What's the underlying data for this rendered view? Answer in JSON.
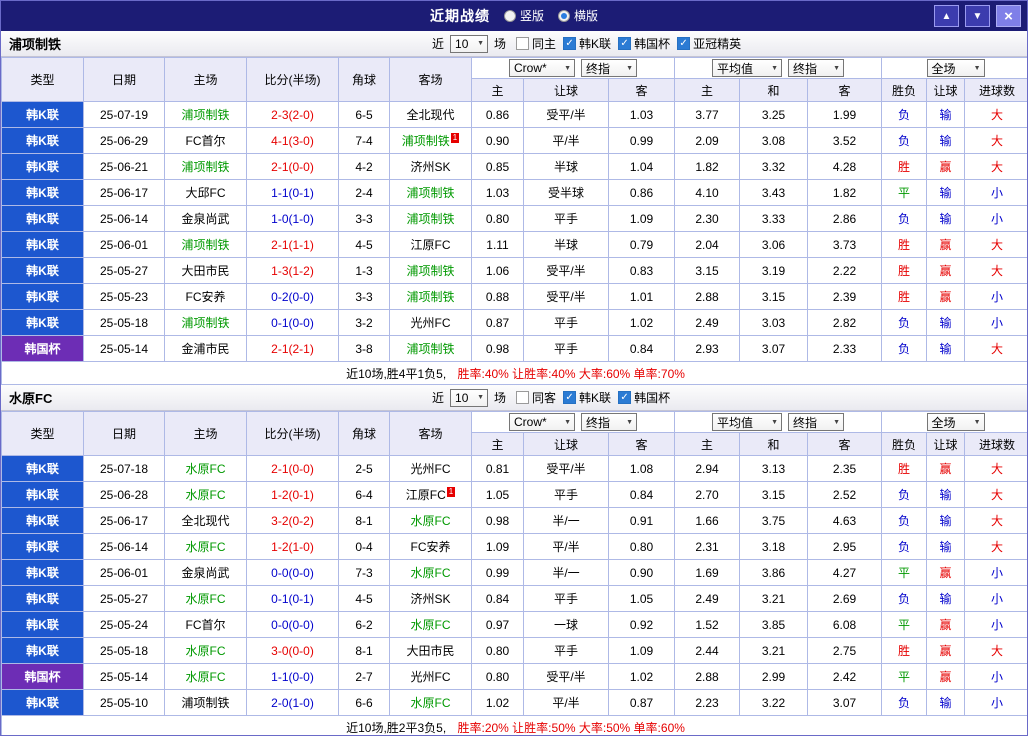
{
  "titlebar": {
    "title": "近期战绩",
    "radios": [
      {
        "label": "竖版",
        "selected": false
      },
      {
        "label": "横版",
        "selected": true
      }
    ],
    "buttons": {
      "up": "▲",
      "down": "▼",
      "close": "×"
    }
  },
  "controls": {
    "near_label": "近",
    "count_value": "10",
    "unit_label": "场",
    "dropdown_arrow": "▼",
    "check_icon": "✓",
    "bk_select": "Crow*",
    "final_select": "终指",
    "avg_select": "平均值",
    "scope_select": "全场"
  },
  "headers": [
    "类型",
    "日期",
    "主场",
    "比分(半场)",
    "角球",
    "客场",
    "主",
    "让球",
    "客",
    "主",
    "和",
    "客",
    "胜负",
    "让球",
    "进球数"
  ],
  "colors": {
    "titlebar_bg": "#1c1c75",
    "league_k_bg": "#1d57cf",
    "league_cup_bg": "#6d2db5",
    "focus_team": "#009900",
    "win_red": "#e60000",
    "draw_green": "#009900",
    "lose_blue": "#0000cc"
  },
  "sections": [
    {
      "team": "浦项制铁",
      "filters": [
        {
          "label": "同主",
          "checked": false
        },
        {
          "label": "韩K联",
          "checked": true
        },
        {
          "label": "韩国杯",
          "checked": true
        },
        {
          "label": "亚冠精英",
          "checked": true
        }
      ],
      "rows": [
        {
          "lg": "韩K联",
          "cup": false,
          "date": "25-07-19",
          "home": "浦项制铁",
          "hf": true,
          "hrc": "",
          "score": "2-3(2-0)",
          "big": true,
          "corner": "6-5",
          "away": "全北现代",
          "af": false,
          "arc": "",
          "ah": [
            "0.86",
            "受平/半",
            "1.03"
          ],
          "eu": [
            "3.77",
            "3.25",
            "1.99"
          ],
          "res": [
            [
              "负",
              "l"
            ],
            [
              "输",
              "l"
            ],
            [
              "大",
              "w"
            ]
          ]
        },
        {
          "lg": "韩K联",
          "cup": false,
          "date": "25-06-29",
          "home": "FC首尔",
          "hf": false,
          "hrc": "",
          "score": "4-1(3-0)",
          "big": true,
          "corner": "7-4",
          "away": "浦项制铁",
          "af": true,
          "arc": "1",
          "ah": [
            "0.90",
            "平/半",
            "0.99"
          ],
          "eu": [
            "2.09",
            "3.08",
            "3.52"
          ],
          "res": [
            [
              "负",
              "l"
            ],
            [
              "输",
              "l"
            ],
            [
              "大",
              "w"
            ]
          ]
        },
        {
          "lg": "韩K联",
          "cup": false,
          "date": "25-06-21",
          "home": "浦项制铁",
          "hf": true,
          "hrc": "",
          "score": "2-1(0-0)",
          "big": true,
          "corner": "4-2",
          "away": "济州SK",
          "af": false,
          "arc": "",
          "ah": [
            "0.85",
            "半球",
            "1.04"
          ],
          "eu": [
            "1.82",
            "3.32",
            "4.28"
          ],
          "res": [
            [
              "胜",
              "w"
            ],
            [
              "赢",
              "w"
            ],
            [
              "大",
              "w"
            ]
          ]
        },
        {
          "lg": "韩K联",
          "cup": false,
          "date": "25-06-17",
          "home": "大邱FC",
          "hf": false,
          "hrc": "",
          "score": "1-1(0-1)",
          "big": false,
          "corner": "2-4",
          "away": "浦项制铁",
          "af": true,
          "arc": "",
          "ah": [
            "1.03",
            "受半球",
            "0.86"
          ],
          "eu": [
            "4.10",
            "3.43",
            "1.82"
          ],
          "res": [
            [
              "平",
              "d"
            ],
            [
              "输",
              "l"
            ],
            [
              "小",
              "l"
            ]
          ]
        },
        {
          "lg": "韩K联",
          "cup": false,
          "date": "25-06-14",
          "home": "金泉尚武",
          "hf": false,
          "hrc": "",
          "score": "1-0(1-0)",
          "big": false,
          "corner": "3-3",
          "away": "浦项制铁",
          "af": true,
          "arc": "",
          "ah": [
            "0.80",
            "平手",
            "1.09"
          ],
          "eu": [
            "2.30",
            "3.33",
            "2.86"
          ],
          "res": [
            [
              "负",
              "l"
            ],
            [
              "输",
              "l"
            ],
            [
              "小",
              "l"
            ]
          ]
        },
        {
          "lg": "韩K联",
          "cup": false,
          "date": "25-06-01",
          "home": "浦项制铁",
          "hf": true,
          "hrc": "",
          "score": "2-1(1-1)",
          "big": true,
          "corner": "4-5",
          "away": "江原FC",
          "af": false,
          "arc": "",
          "ah": [
            "1.11",
            "半球",
            "0.79"
          ],
          "eu": [
            "2.04",
            "3.06",
            "3.73"
          ],
          "res": [
            [
              "胜",
              "w"
            ],
            [
              "赢",
              "w"
            ],
            [
              "大",
              "w"
            ]
          ]
        },
        {
          "lg": "韩K联",
          "cup": false,
          "date": "25-05-27",
          "home": "大田市民",
          "hf": false,
          "hrc": "",
          "score": "1-3(1-2)",
          "big": true,
          "corner": "1-3",
          "away": "浦项制铁",
          "af": true,
          "arc": "",
          "ah": [
            "1.06",
            "受平/半",
            "0.83"
          ],
          "eu": [
            "3.15",
            "3.19",
            "2.22"
          ],
          "res": [
            [
              "胜",
              "w"
            ],
            [
              "赢",
              "w"
            ],
            [
              "大",
              "w"
            ]
          ]
        },
        {
          "lg": "韩K联",
          "cup": false,
          "date": "25-05-23",
          "home": "FC安养",
          "hf": false,
          "hrc": "",
          "score": "0-2(0-0)",
          "big": false,
          "corner": "3-3",
          "away": "浦项制铁",
          "af": true,
          "arc": "",
          "ah": [
            "0.88",
            "受平/半",
            "1.01"
          ],
          "eu": [
            "2.88",
            "3.15",
            "2.39"
          ],
          "res": [
            [
              "胜",
              "w"
            ],
            [
              "赢",
              "w"
            ],
            [
              "小",
              "l"
            ]
          ]
        },
        {
          "lg": "韩K联",
          "cup": false,
          "date": "25-05-18",
          "home": "浦项制铁",
          "hf": true,
          "hrc": "",
          "score": "0-1(0-0)",
          "big": false,
          "corner": "3-2",
          "away": "光州FC",
          "af": false,
          "arc": "",
          "ah": [
            "0.87",
            "平手",
            "1.02"
          ],
          "eu": [
            "2.49",
            "3.03",
            "2.82"
          ],
          "res": [
            [
              "负",
              "l"
            ],
            [
              "输",
              "l"
            ],
            [
              "小",
              "l"
            ]
          ]
        },
        {
          "lg": "韩国杯",
          "cup": true,
          "date": "25-05-14",
          "home": "金浦市民",
          "hf": false,
          "hrc": "",
          "score": "2-1(2-1)",
          "big": true,
          "corner": "3-8",
          "away": "浦项制铁",
          "af": true,
          "arc": "",
          "ah": [
            "0.98",
            "平手",
            "0.84"
          ],
          "eu": [
            "2.93",
            "3.07",
            "2.33"
          ],
          "res": [
            [
              "负",
              "l"
            ],
            [
              "输",
              "l"
            ],
            [
              "大",
              "w"
            ]
          ]
        }
      ],
      "summary_plain": "近10场,胜4平1负5,",
      "summary_rates": "胜率:40% 让胜率:40% 大率:60% 单率:70%"
    },
    {
      "team": "水原FC",
      "filters": [
        {
          "label": "同客",
          "checked": false
        },
        {
          "label": "韩K联",
          "checked": true
        },
        {
          "label": "韩国杯",
          "checked": true
        }
      ],
      "rows": [
        {
          "lg": "韩K联",
          "cup": false,
          "date": "25-07-18",
          "home": "水原FC",
          "hf": true,
          "hrc": "",
          "score": "2-1(0-0)",
          "big": true,
          "corner": "2-5",
          "away": "光州FC",
          "af": false,
          "arc": "",
          "ah": [
            "0.81",
            "受平/半",
            "1.08"
          ],
          "eu": [
            "2.94",
            "3.13",
            "2.35"
          ],
          "res": [
            [
              "胜",
              "w"
            ],
            [
              "赢",
              "w"
            ],
            [
              "大",
              "w"
            ]
          ]
        },
        {
          "lg": "韩K联",
          "cup": false,
          "date": "25-06-28",
          "home": "水原FC",
          "hf": true,
          "hrc": "",
          "score": "1-2(0-1)",
          "big": true,
          "corner": "6-4",
          "away": "江原FC",
          "af": false,
          "arc": "1",
          "ah": [
            "1.05",
            "平手",
            "0.84"
          ],
          "eu": [
            "2.70",
            "3.15",
            "2.52"
          ],
          "res": [
            [
              "负",
              "l"
            ],
            [
              "输",
              "l"
            ],
            [
              "大",
              "w"
            ]
          ]
        },
        {
          "lg": "韩K联",
          "cup": false,
          "date": "25-06-17",
          "home": "全北现代",
          "hf": false,
          "hrc": "",
          "score": "3-2(0-2)",
          "big": true,
          "corner": "8-1",
          "away": "水原FC",
          "af": true,
          "arc": "",
          "ah": [
            "0.98",
            "半/一",
            "0.91"
          ],
          "eu": [
            "1.66",
            "3.75",
            "4.63"
          ],
          "res": [
            [
              "负",
              "l"
            ],
            [
              "输",
              "l"
            ],
            [
              "大",
              "w"
            ]
          ]
        },
        {
          "lg": "韩K联",
          "cup": false,
          "date": "25-06-14",
          "home": "水原FC",
          "hf": true,
          "hrc": "",
          "score": "1-2(1-0)",
          "big": true,
          "corner": "0-4",
          "away": "FC安养",
          "af": false,
          "arc": "",
          "ah": [
            "1.09",
            "平/半",
            "0.80"
          ],
          "eu": [
            "2.31",
            "3.18",
            "2.95"
          ],
          "res": [
            [
              "负",
              "l"
            ],
            [
              "输",
              "l"
            ],
            [
              "大",
              "w"
            ]
          ]
        },
        {
          "lg": "韩K联",
          "cup": false,
          "date": "25-06-01",
          "home": "金泉尚武",
          "hf": false,
          "hrc": "",
          "score": "0-0(0-0)",
          "big": false,
          "corner": "7-3",
          "away": "水原FC",
          "af": true,
          "arc": "",
          "ah": [
            "0.99",
            "半/一",
            "0.90"
          ],
          "eu": [
            "1.69",
            "3.86",
            "4.27"
          ],
          "res": [
            [
              "平",
              "d"
            ],
            [
              "赢",
              "w"
            ],
            [
              "小",
              "l"
            ]
          ]
        },
        {
          "lg": "韩K联",
          "cup": false,
          "date": "25-05-27",
          "home": "水原FC",
          "hf": true,
          "hrc": "",
          "score": "0-1(0-1)",
          "big": false,
          "corner": "4-5",
          "away": "济州SK",
          "af": false,
          "arc": "",
          "ah": [
            "0.84",
            "平手",
            "1.05"
          ],
          "eu": [
            "2.49",
            "3.21",
            "2.69"
          ],
          "res": [
            [
              "负",
              "l"
            ],
            [
              "输",
              "l"
            ],
            [
              "小",
              "l"
            ]
          ]
        },
        {
          "lg": "韩K联",
          "cup": false,
          "date": "25-05-24",
          "home": "FC首尔",
          "hf": false,
          "hrc": "",
          "score": "0-0(0-0)",
          "big": false,
          "corner": "6-2",
          "away": "水原FC",
          "af": true,
          "arc": "",
          "ah": [
            "0.97",
            "一球",
            "0.92"
          ],
          "eu": [
            "1.52",
            "3.85",
            "6.08"
          ],
          "res": [
            [
              "平",
              "d"
            ],
            [
              "赢",
              "w"
            ],
            [
              "小",
              "l"
            ]
          ]
        },
        {
          "lg": "韩K联",
          "cup": false,
          "date": "25-05-18",
          "home": "水原FC",
          "hf": true,
          "hrc": "",
          "score": "3-0(0-0)",
          "big": true,
          "corner": "8-1",
          "away": "大田市民",
          "af": false,
          "arc": "",
          "ah": [
            "0.80",
            "平手",
            "1.09"
          ],
          "eu": [
            "2.44",
            "3.21",
            "2.75"
          ],
          "res": [
            [
              "胜",
              "w"
            ],
            [
              "赢",
              "w"
            ],
            [
              "大",
              "w"
            ]
          ]
        },
        {
          "lg": "韩国杯",
          "cup": true,
          "date": "25-05-14",
          "home": "水原FC",
          "hf": true,
          "hrc": "",
          "score": "1-1(0-0)",
          "big": false,
          "corner": "2-7",
          "away": "光州FC",
          "af": false,
          "arc": "",
          "ah": [
            "0.80",
            "受平/半",
            "1.02"
          ],
          "eu": [
            "2.88",
            "2.99",
            "2.42"
          ],
          "res": [
            [
              "平",
              "d"
            ],
            [
              "赢",
              "w"
            ],
            [
              "小",
              "l"
            ]
          ]
        },
        {
          "lg": "韩K联",
          "cup": false,
          "date": "25-05-10",
          "home": "浦项制铁",
          "hf": false,
          "hrc": "",
          "score": "2-0(1-0)",
          "big": false,
          "corner": "6-6",
          "away": "水原FC",
          "af": true,
          "arc": "",
          "ah": [
            "1.02",
            "平/半",
            "0.87"
          ],
          "eu": [
            "2.23",
            "3.22",
            "3.07"
          ],
          "res": [
            [
              "负",
              "l"
            ],
            [
              "输",
              "l"
            ],
            [
              "小",
              "l"
            ]
          ]
        }
      ],
      "summary_plain": "近10场,胜2平3负5,",
      "summary_rates": "胜率:20% 让胜率:50% 大率:50% 单率:60%"
    }
  ]
}
